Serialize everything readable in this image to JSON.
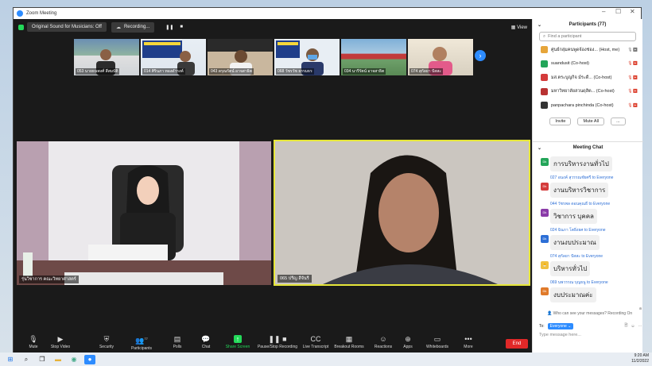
{
  "window": {
    "title": "Zoom Meeting"
  },
  "topstrip": {
    "original_sound": "Original Sound for Musicians: Off",
    "recording": "Recording...",
    "view": "View"
  },
  "gallery": [
    {
      "name": "053 นายธนพงศ์ สีสมบัติ"
    },
    {
      "name": "014 ศิรินภา ทองดำรงค์"
    },
    {
      "name": "043 ดรุณรัตน์ อาจสาธิต"
    },
    {
      "name": "068 วัชรวัช ธรรมธร"
    },
    {
      "name": "034 นารีรัตน์ อาจสาธิต"
    },
    {
      "name": "074 สุกัลยา ปัสสะ"
    }
  ],
  "videos": {
    "left_caption": "รุ่นวิชาการ คณะวิทยาศาสตร์",
    "right_caption": "065 ปรีญ สีจันรี"
  },
  "toolbar": {
    "mute": "Mute",
    "stop_video": "Stop Video",
    "security": "Security",
    "participants": "Participants",
    "participants_count": "77",
    "polls": "Polls",
    "chat": "Chat",
    "share_screen": "Share Screen",
    "pause_recording": "Pause/Stop Recording",
    "live_transcript": "Live Transcript",
    "breakout_rooms": "Breakout Rooms",
    "reactions": "Reactions",
    "apps": "Apps",
    "whiteboards": "Whiteboards",
    "more": "More",
    "end": "End"
  },
  "participants": {
    "header": "Participants (77)",
    "search_placeholder": "Find a participant",
    "list": [
      {
        "name": "ศูนย์กลุ่มคนพูดจ้องช่อง...",
        "role": "(Host, me)",
        "color": "#e6a53a"
      },
      {
        "name": "suandusit",
        "role": "(Co-host)",
        "color": "#23a559"
      },
      {
        "name": "มส.ตระบูญกิจ ม์ระดี...",
        "role": "(Co-host)",
        "color": "#d43b3b"
      },
      {
        "name": "มหาวิทยาลัยสวนดุสิต...",
        "role": "(Co-host)",
        "color": "#b83232"
      },
      {
        "name": "panpachara pinchinda",
        "role": "(Co-host)",
        "color": "#333333"
      }
    ],
    "invite": "Invite",
    "mute_all": "Mute All",
    "more": "..."
  },
  "chat": {
    "header": "Meeting Chat",
    "messages": [
      {
        "from": "",
        "avatar": "Dk",
        "avatar_color": "#23a559",
        "text": "การบริหารงานทั่วไป"
      },
      {
        "from": "027 อนงค์ สุวรรณชัยศรี to Everyone",
        "avatar": "Dk",
        "avatar_color": "#d43b3b",
        "text": "งานบริหารวิชาการ"
      },
      {
        "from": "044 วัชรพล ดอนคุณธี to Everyone",
        "avatar": "Dk",
        "avatar_color": "#8a3ba8",
        "text": "วิชาการ บุคคล"
      },
      {
        "from": "024 ฉินภา โตยิ่งยศ to Everyone",
        "avatar": "Dk",
        "avatar_color": "#2d6fd6",
        "text": "งานงบประมาณ"
      },
      {
        "from": "074 สุกัลยา ปัสสะ to Everyone",
        "avatar": "🐣",
        "avatar_color": "#f0c040",
        "text": "บริหารทั่วไป"
      },
      {
        "from": "069 นพวรรณ บุญธนู to Everyone",
        "avatar": "Dk",
        "avatar_color": "#e07a2a",
        "text": "งบประมาณค่ะ"
      }
    ],
    "who_can_see": "Who can see your messages? Recording On",
    "to_label": "To:",
    "to_target": "Everyone",
    "placeholder": "Type message here..."
  },
  "taskbar": {
    "time": "9:20 AM",
    "date": "11/2/2022"
  }
}
